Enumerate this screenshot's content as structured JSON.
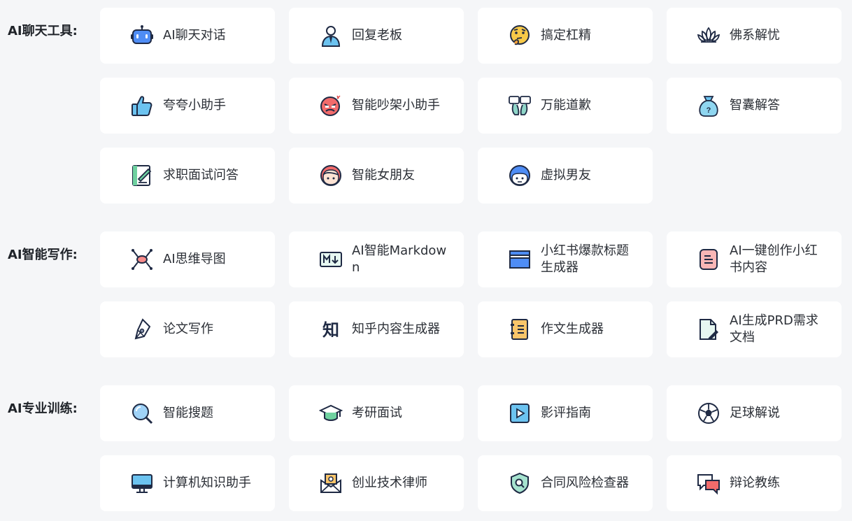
{
  "sections": [
    {
      "title": "AI聊天工具:",
      "items": [
        {
          "label": "AI聊天对话",
          "icon": "robot-chat-icon"
        },
        {
          "label": "回复老板",
          "icon": "boss-person-icon"
        },
        {
          "label": "搞定杠精",
          "icon": "thinking-face-icon"
        },
        {
          "label": "佛系解忧",
          "icon": "lotus-icon"
        },
        {
          "label": "夸夸小助手",
          "icon": "thumbs-up-icon"
        },
        {
          "label": "智能吵架小助手",
          "icon": "angry-face-icon"
        },
        {
          "label": "万能道歉",
          "icon": "apology-icon"
        },
        {
          "label": "智囊解答",
          "icon": "question-bag-icon"
        },
        {
          "label": "求职面试问答",
          "icon": "resume-edit-icon"
        },
        {
          "label": "智能女朋友",
          "icon": "girlfriend-avatar-icon"
        },
        {
          "label": "虚拟男友",
          "icon": "boyfriend-avatar-icon"
        }
      ]
    },
    {
      "title": "AI智能写作:",
      "items": [
        {
          "label": "AI思维导图",
          "icon": "mind-map-icon"
        },
        {
          "label": "AI智能Markdown",
          "icon": "markdown-icon"
        },
        {
          "label": "小红书爆款标题生成器",
          "icon": "browser-window-icon"
        },
        {
          "label": "AI一键创作小红书内容",
          "icon": "red-note-icon"
        },
        {
          "label": "论文写作",
          "icon": "pen-nib-icon"
        },
        {
          "label": "知乎内容生成器",
          "icon": "zhihu-icon"
        },
        {
          "label": "作文生成器",
          "icon": "essay-notebook-icon"
        },
        {
          "label": "AI生成PRD需求文档",
          "icon": "document-edit-icon"
        }
      ]
    },
    {
      "title": "AI专业训练:",
      "items": [
        {
          "label": "智能搜题",
          "icon": "magnifier-icon"
        },
        {
          "label": "考研面试",
          "icon": "graduation-cap-icon"
        },
        {
          "label": "影评指南",
          "icon": "video-play-icon"
        },
        {
          "label": "足球解说",
          "icon": "football-icon"
        },
        {
          "label": "计算机知识助手",
          "icon": "computer-monitor-icon"
        },
        {
          "label": "创业技术律师",
          "icon": "lawyer-envelope-icon"
        },
        {
          "label": "合同风险检查器",
          "icon": "shield-search-icon"
        },
        {
          "label": "辩论教练",
          "icon": "chat-bubbles-icon"
        }
      ]
    }
  ]
}
